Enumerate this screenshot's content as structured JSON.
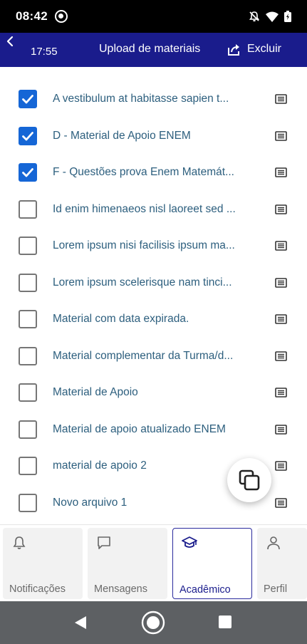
{
  "status_bar": {
    "time": "08:42"
  },
  "header": {
    "back_icon": "chevron-left-icon",
    "time": "17:55",
    "title": "Upload de materiais",
    "delete_icon": "share-export-icon",
    "delete_label": "Excluir",
    "background": "#1a1c8c"
  },
  "materials": [
    {
      "label": "A vestibulum at habitasse sapien t...",
      "checked": true
    },
    {
      "label": "D - Material de Apoio ENEM",
      "checked": true
    },
    {
      "label": "F - Questões prova Enem Matemát...",
      "checked": true
    },
    {
      "label": "Id enim himenaeos nisl laoreet sed ...",
      "checked": false
    },
    {
      "label": "Lorem ipsum nisi facilisis ipsum ma...",
      "checked": false
    },
    {
      "label": "Lorem ipsum scelerisque nam tinci...",
      "checked": false
    },
    {
      "label": "Material com data expirada.",
      "checked": false
    },
    {
      "label": "Material complementar da Turma/d...",
      "checked": false
    },
    {
      "label": "Material de Apoio",
      "checked": false
    },
    {
      "label": "Material de apoio atualizado ENEM",
      "checked": false
    },
    {
      "label": "material de apoio 2",
      "checked": false
    },
    {
      "label": "Novo arquivo 1",
      "checked": false
    }
  ],
  "fab": {
    "icon": "copy-icon"
  },
  "bottom_nav": [
    {
      "label": "Notificações",
      "icon": "bell-icon",
      "active": false
    },
    {
      "label": "Mensagens",
      "icon": "message-icon",
      "active": false
    },
    {
      "label": "Acadêmico",
      "icon": "graduation-cap-icon",
      "active": true
    },
    {
      "label": "Perfil",
      "icon": "person-icon",
      "active": false
    }
  ],
  "colors": {
    "checkbox_checked": "#1566d6",
    "label_text": "#2d5f7e",
    "accent": "#1a1c8c"
  }
}
